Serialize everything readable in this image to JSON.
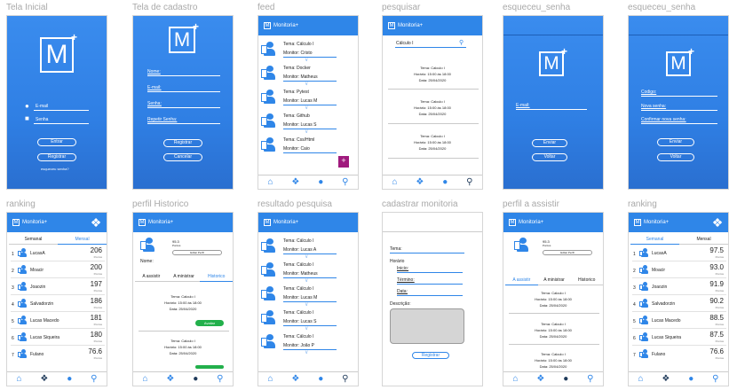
{
  "titles": {
    "inicial": "Tela Inicial",
    "cadastro": "Tela de cadastro",
    "feed": "feed",
    "pesquisar": "pesquisar",
    "esqueceu1": "esqueceu_senha",
    "esqueceu2": "esqueceu_senha",
    "ranking1": "ranking",
    "perfil_hist": "perfil Historico",
    "resultado": "resultado pesquisa",
    "cad_monitoria": "cadastrar monitoria",
    "perfil_assistir": "perfil a assistir",
    "ranking2": "ranking"
  },
  "app": {
    "logo_letter": "M",
    "logo_plus": "+",
    "header": "Monitoria+",
    "mini_logo": "M"
  },
  "colors": {
    "primary": "#2f86e8",
    "green": "#22b04b",
    "purple": "#a01a7d"
  },
  "inicial": {
    "email": "E-mail",
    "senha": "Senha",
    "entrar": "Entrar",
    "registrar": "Registrar",
    "esqueceu": "esqueceu senha?"
  },
  "cadastro": {
    "nome": "Nome:",
    "email": "E-mail:",
    "senha": "Senha:",
    "repetir": "Repetir Senha:",
    "registrar": "Registrar",
    "cancelar": "Cancelar"
  },
  "feed": {
    "items": [
      {
        "tema": "Tema: Cálculo I",
        "monitor": "Monitor: Cristo"
      },
      {
        "tema": "Tema: Docker",
        "monitor": "Monitor: Matheus"
      },
      {
        "tema": "Tema: Pytest",
        "monitor": "Monitor: Lucas M"
      },
      {
        "tema": "Tema: Github",
        "monitor": "Monitor: Lucas S"
      },
      {
        "tema": "Tema: Css/Html",
        "monitor": "Monitor: Caio"
      }
    ],
    "add_icon": "plus-icon"
  },
  "pesquisar": {
    "query": "Cálculo I",
    "results": [
      {
        "tema": "Tema: Calculo I",
        "horario": "Horário: 15:00 às 18:00",
        "data": "Data: 25/04/2020"
      },
      {
        "tema": "Tema: Calculo I",
        "horario": "Horário: 15:00 às 18:00",
        "data": "Data: 25/04/2020"
      },
      {
        "tema": "Tema: Calculo I",
        "horario": "Horário: 15:00 às 18:00",
        "data": "Data: 25/04/2020"
      }
    ]
  },
  "esqueceu1": {
    "email": "E-mail:",
    "enviar": "Enviar",
    "voltar": "Voltar"
  },
  "esqueceu2": {
    "codigo": "Codigo:",
    "nova": "Nova senha:",
    "confirmar": "Confirmar nova senha:",
    "enviar": "Enviar",
    "voltar": "Voltar"
  },
  "ranking1": {
    "tabs": [
      "Semanal",
      "Mensal"
    ],
    "rows": [
      {
        "pos": "1",
        "name": "LucasA",
        "points": "206",
        "label": "Pontos"
      },
      {
        "pos": "2",
        "name": "Moacir",
        "points": "200",
        "label": "Pontos"
      },
      {
        "pos": "3",
        "name": "Joaozin",
        "points": "197",
        "label": "Pontos"
      },
      {
        "pos": "4",
        "name": "Salvadorzin",
        "points": "186",
        "label": "Pontos"
      },
      {
        "pos": "5",
        "name": "Lucas Macedo",
        "points": "181",
        "label": "Pontos"
      },
      {
        "pos": "6",
        "name": "Lucas Siqueira",
        "points": "180",
        "label": "Pontos"
      },
      {
        "pos": "7",
        "name": "Fulano",
        "points": "76.6",
        "label": "Pontos"
      }
    ]
  },
  "perfil_hist": {
    "score": "95.3",
    "score_label": "Pontos",
    "edit": "Editar Perfil",
    "nome": "Nome:",
    "tabs": [
      "A assistir",
      "A ministrar",
      "Historico"
    ],
    "items": [
      {
        "tema": "Tema: Calculo I",
        "horario": "Horário: 15:00 às 18:00",
        "data": "Data: 25/04/2020",
        "btn": "Avaliar"
      },
      {
        "tema": "Tema: Calculo I",
        "horario": "Horário: 15:00 às 18:00",
        "data": "Data: 25/04/2020"
      }
    ]
  },
  "resultado": {
    "items": [
      {
        "tema": "Tema: Cálculo I",
        "monitor": "Monitor: Lucas A"
      },
      {
        "tema": "Tema: Cálculo I",
        "monitor": "Monitor: Matheus"
      },
      {
        "tema": "Tema: Cálculo I",
        "monitor": "Monitor: Lucas M"
      },
      {
        "tema": "Tema: Cálculo I",
        "monitor": "Monitor: Lucas S"
      },
      {
        "tema": "Tema: Cálculo I",
        "monitor": "Monitor: João P"
      }
    ]
  },
  "cad_monitoria": {
    "tema": "Tema:",
    "horario": "Horário",
    "inicio": "Inicio:",
    "termino": "Término:",
    "data": "Data:",
    "descricao": "Descrição:",
    "registrar": "Registrar"
  },
  "perfil_assistir": {
    "score": "95.3",
    "score_label": "Pontos",
    "edit": "Editar Perfil",
    "tabs": [
      "A assistir",
      "A ministrar",
      "Historico"
    ],
    "items": [
      {
        "tema": "Tema: Calculo I",
        "horario": "Horário: 15:00 às 18:00",
        "data": "Data: 25/04/2020"
      },
      {
        "tema": "Tema: Calculo I",
        "horario": "Horário: 15:00 às 18:00",
        "data": "Data: 25/04/2020"
      },
      {
        "tema": "Tema: Calculo I",
        "horario": "Horário: 15:00 às 18:00",
        "data": "Data: 25/04/2020"
      }
    ]
  },
  "ranking2": {
    "tabs": [
      "Semanal",
      "Mensal"
    ],
    "rows": [
      {
        "pos": "1",
        "name": "LucasA",
        "points": "97.5",
        "label": "Pontos"
      },
      {
        "pos": "2",
        "name": "Moacir",
        "points": "93.0",
        "label": "Pontos"
      },
      {
        "pos": "3",
        "name": "Joaozin",
        "points": "91.9",
        "label": "Pontos"
      },
      {
        "pos": "4",
        "name": "Salvadorzin",
        "points": "90.2",
        "label": "Pontos"
      },
      {
        "pos": "5",
        "name": "Lucas Macedo",
        "points": "88.5",
        "label": "Pontos"
      },
      {
        "pos": "6",
        "name": "Lucas Siqueira",
        "points": "87.5",
        "label": "Pontos"
      },
      {
        "pos": "7",
        "name": "Fulano",
        "points": "76.6",
        "label": "Pontos"
      }
    ]
  },
  "nav_icons": [
    "home-icon",
    "medal-icon",
    "user-icon",
    "search-icon"
  ]
}
